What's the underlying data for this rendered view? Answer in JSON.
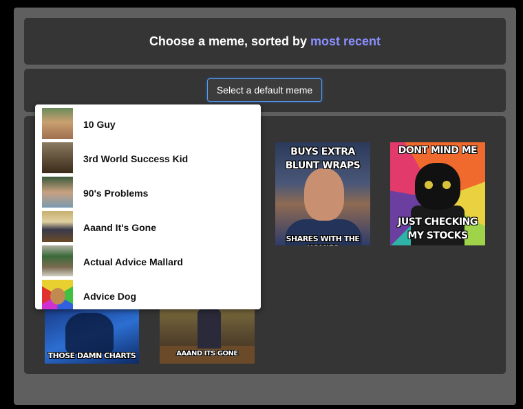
{
  "header": {
    "title_prefix": "Choose a meme, sorted by",
    "sort_link": "most recent"
  },
  "picker": {
    "button_label": "Select a default meme"
  },
  "dropdown": {
    "items": [
      {
        "label": "10 Guy",
        "icon": "10-guy-thumbnail",
        "color": "#c8a070"
      },
      {
        "label": "3rd World Success Kid",
        "icon": "3rd-world-success-kid-thumbnail",
        "color": "#6a5a45"
      },
      {
        "label": "90's Problems",
        "icon": "90s-problems-thumbnail",
        "color": "#5f7a5a"
      },
      {
        "label": "Aaand It's Gone",
        "icon": "aaand-its-gone-thumbnail",
        "color": "#8a7a4a"
      },
      {
        "label": "Actual Advice Mallard",
        "icon": "actual-advice-mallard-thumbnail",
        "color": "#7a8a6a"
      },
      {
        "label": "Advice Dog",
        "icon": "advice-dog-thumbnail",
        "color": "#e8c030"
      }
    ]
  },
  "gallery": {
    "thumbs": [
      {
        "top": "BUYS EXTRA BLUNT WRAPS",
        "bottom": "SHARES WITH THE HOMIES"
      },
      {
        "top": "DONT MIND ME",
        "bottom": "JUST CHECKING MY STOCKS"
      },
      {
        "top": "",
        "bottom": "THOSE DAMN CHARTS"
      },
      {
        "top": "",
        "bottom": "AAAND ITS GONE"
      }
    ]
  }
}
